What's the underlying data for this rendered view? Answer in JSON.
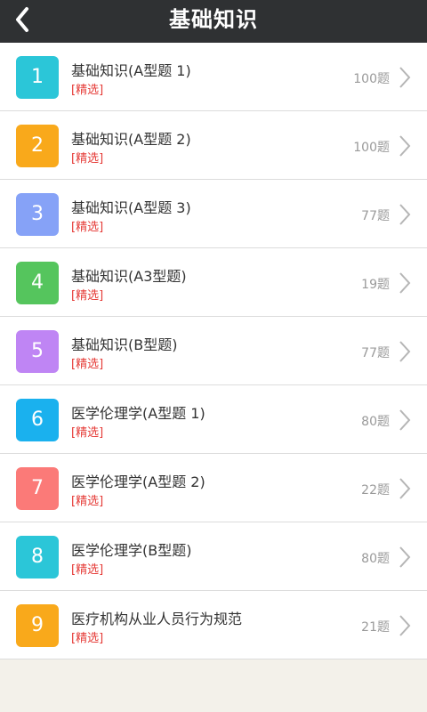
{
  "header": {
    "title": "基础知识"
  },
  "items": [
    {
      "number": "1",
      "title": "基础知识(A型题 1)",
      "tag": "[精选]",
      "count": "100题",
      "color": "#2bc6d8"
    },
    {
      "number": "2",
      "title": "基础知识(A型题 2)",
      "tag": "[精选]",
      "count": "100题",
      "color": "#f9a91b"
    },
    {
      "number": "3",
      "title": "基础知识(A型题 3)",
      "tag": "[精选]",
      "count": "77题",
      "color": "#86a2f7"
    },
    {
      "number": "4",
      "title": "基础知识(A3型题)",
      "tag": "[精选]",
      "count": "19题",
      "color": "#55c55d"
    },
    {
      "number": "5",
      "title": "基础知识(B型题)",
      "tag": "[精选]",
      "count": "77题",
      "color": "#bf85f4"
    },
    {
      "number": "6",
      "title": "医学伦理学(A型题 1)",
      "tag": "[精选]",
      "count": "80题",
      "color": "#1ab1ee"
    },
    {
      "number": "7",
      "title": "医学伦理学(A型题 2)",
      "tag": "[精选]",
      "count": "22题",
      "color": "#fb7a78"
    },
    {
      "number": "8",
      "title": "医学伦理学(B型题)",
      "tag": "[精选]",
      "count": "80题",
      "color": "#2bc6d8"
    },
    {
      "number": "9",
      "title": "医疗机构从业人员行为规范",
      "tag": "[精选]",
      "count": "21题",
      "color": "#f9a91b"
    }
  ]
}
